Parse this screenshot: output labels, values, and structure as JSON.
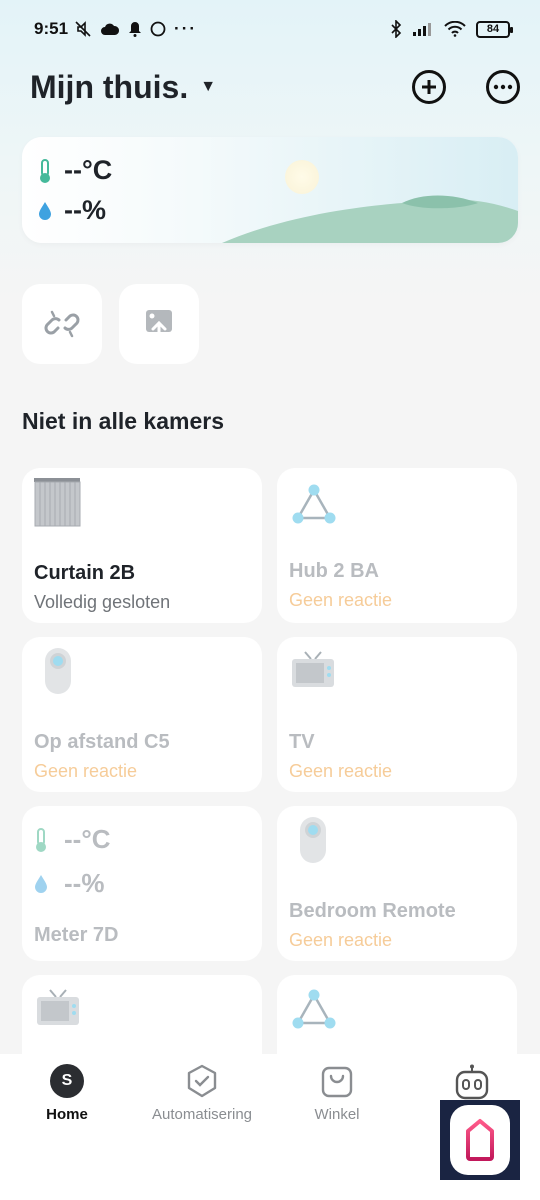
{
  "status_bar": {
    "time": "9:51",
    "left_icons": [
      "mute-icon",
      "cloud-icon",
      "bell-icon",
      "circle-icon",
      "more-dots"
    ],
    "right_icons": [
      "bluetooth-icon",
      "signal-icon",
      "wifi-icon"
    ],
    "battery": "84"
  },
  "header": {
    "title": "Mijn thuis.",
    "add_icon": "plus-circle-icon",
    "more_icon": "more-circle-icon"
  },
  "weather": {
    "temperature": "--°C",
    "humidity": "--%"
  },
  "quick_actions": [
    {
      "icon": "link-icon"
    },
    {
      "icon": "upload-image-icon"
    }
  ],
  "section_title": "Niet in alle kamers",
  "devices": [
    {
      "name": "Curtain 2B",
      "status": "Volledig gesloten",
      "icon": "curtain-icon",
      "online": true
    },
    {
      "name": "Hub 2 BA",
      "status": "Geen reactie",
      "icon": "hub-icon",
      "online": false
    },
    {
      "name": "Op afstand C5",
      "status": "Geen reactie",
      "icon": "remote-icon",
      "online": false
    },
    {
      "name": "TV",
      "status": "Geen reactie",
      "icon": "tv-icon",
      "online": false
    },
    {
      "name": "Meter 7D",
      "temperature": "--°C",
      "humidity": "--%",
      "icon": "meter-icon",
      "online": false
    },
    {
      "name": "Bedroom Remote",
      "status": "Geen reactie",
      "icon": "remote-icon",
      "online": false
    },
    {
      "icon": "tv-icon"
    },
    {
      "icon": "hub-icon"
    }
  ],
  "bottom_nav": {
    "avatar_letter": "S",
    "items": [
      {
        "label": "Home",
        "icon": "avatar",
        "active": true
      },
      {
        "label": "Automatisering",
        "icon": "shield-check-icon",
        "active": false
      },
      {
        "label": "Winkel",
        "icon": "shopping-bag-icon",
        "active": false
      },
      {
        "label": "",
        "icon": "robot-icon",
        "active": false
      }
    ]
  },
  "colors": {
    "accent_offline": "#f6cc99",
    "text_dark": "#1f2329",
    "text_muted": "#b9bcc0",
    "icon_blue": "#9fdcf0",
    "hill_green": "#9ccab6"
  }
}
